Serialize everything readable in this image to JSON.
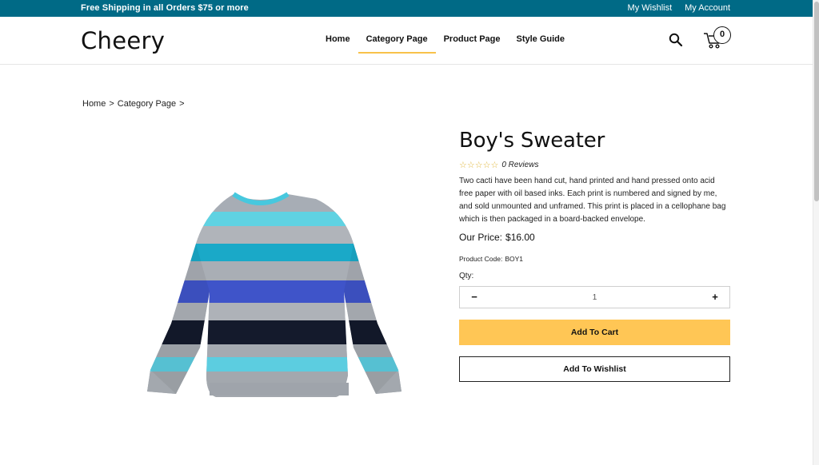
{
  "topbar": {
    "shipping_text": "Free Shipping in all Orders $75 or more",
    "wishlist_link": "My Wishlist",
    "account_link": "My Account",
    "background": "#006a86"
  },
  "header": {
    "logo": "Cheery",
    "nav": [
      "Home",
      "Category Page",
      "Product Page",
      "Style Guide"
    ],
    "active_nav": "Category Page",
    "cart_count": "0",
    "accent": "#f8c24a"
  },
  "breadcrumb": {
    "items": [
      "Home",
      ">",
      "Category Page",
      ">"
    ]
  },
  "product": {
    "title": "Boy's Sweater",
    "stars": "☆☆☆☆☆",
    "reviews": "0 Reviews",
    "description": "Two cacti have been hand cut, hand printed and hand pressed onto acid free paper with oil based inks. Each print is numbered and signed by me, and sold unmounted and unframed. This print is placed in a cellophane bag which is then packaged in a board-backed envelope.",
    "price_label": "Our Price:",
    "price": "$16.00",
    "code_label": "Product Code:",
    "code": "BOY1",
    "qty_label": "Qty:",
    "qty_value": "1",
    "qty_minus": "−",
    "qty_plus": "+",
    "add_to_cart": "Add To Cart",
    "add_to_wishlist": "Add To Wishlist",
    "cart_button_color": "#ffc655",
    "image_icon": "striped-sweater"
  }
}
